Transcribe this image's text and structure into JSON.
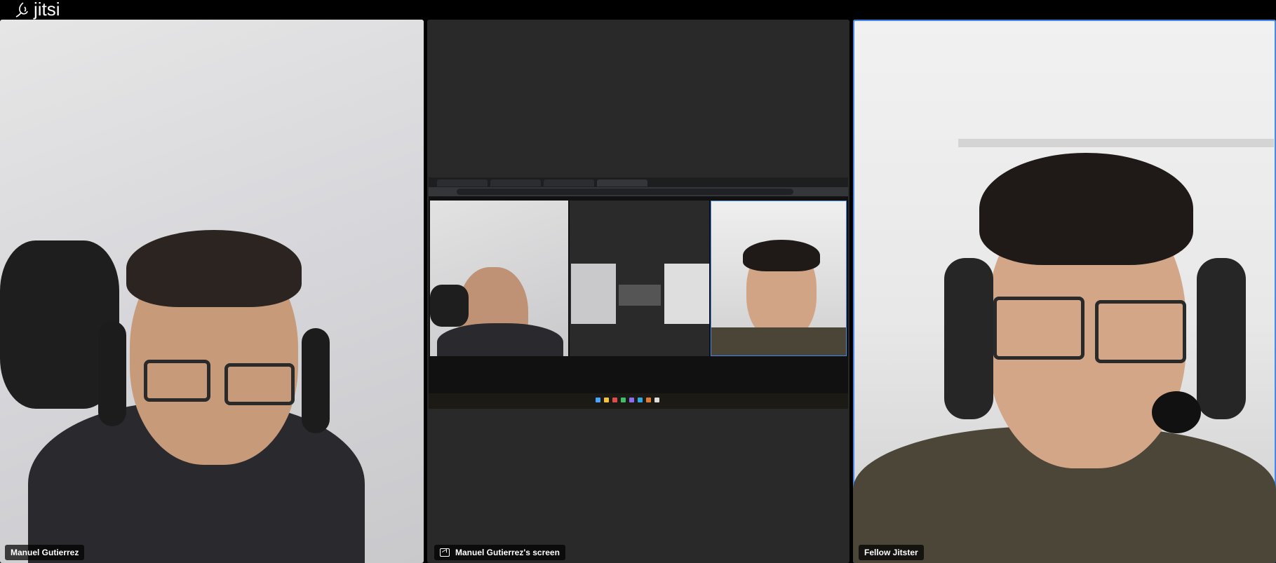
{
  "app": {
    "logo_text": "jitsi"
  },
  "participants": [
    {
      "name": "Manuel Gutierrez"
    },
    {
      "name": "Manuel Gutierrez's screen"
    },
    {
      "name": "Fellow Jitster"
    }
  ],
  "colors": {
    "active_speaker_border": "#4687ed",
    "tile_background": "#292929"
  }
}
